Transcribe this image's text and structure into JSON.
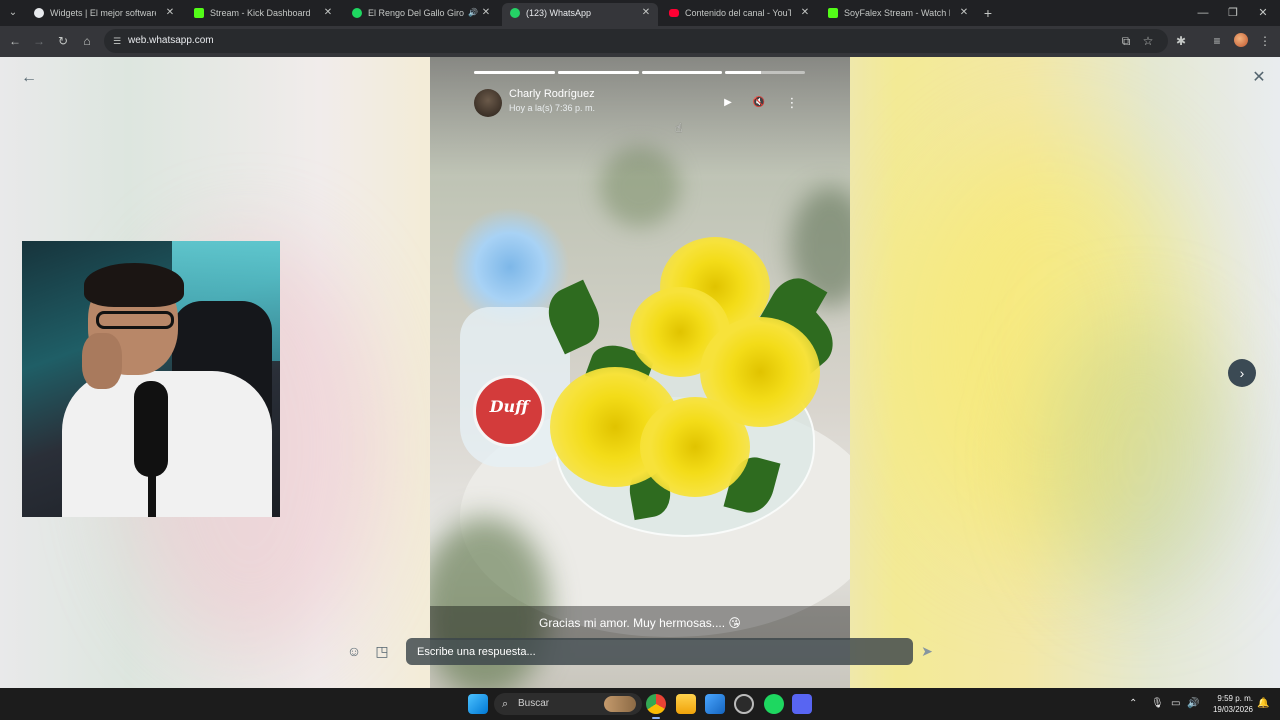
{
  "browser": {
    "tabs": [
      {
        "title": "Widgets | El mejor software pa",
        "favicon": "widgets-favicon-icon",
        "active": false
      },
      {
        "title": "Stream - Kick Dashboard",
        "favicon": "kick-favicon-icon",
        "active": false
      },
      {
        "title": "El Rengo Del Gallo Giro • L",
        "favicon": "spotify-favicon-icon",
        "active": false,
        "audio": true
      },
      {
        "title": "(123) WhatsApp",
        "favicon": "whatsapp-favicon-icon",
        "active": true
      },
      {
        "title": "Contenido del canal - YouTube",
        "favicon": "youtube-favicon-icon",
        "active": false
      },
      {
        "title": "SoyFalex Stream - Watch Live o",
        "favicon": "kick-favicon-icon",
        "active": false
      }
    ],
    "url": "web.whatsapp.com",
    "colors": {
      "tab_bar": "#202124",
      "toolbar": "#35363a",
      "kick": "#53fc18",
      "spotify": "#1ed760",
      "whatsapp": "#25d366",
      "youtube": "#ff0033"
    }
  },
  "status": {
    "contact_name": "Charly Rodríguez",
    "timestamp": "Hoy a la(s) 7:36 p. m.",
    "caption": "Gracias mi amor. Muy hermosas.... 😘",
    "progress": [
      1.0,
      1.0,
      1.0,
      0.45,
      0.0
    ],
    "photo_label": "Duff"
  },
  "reply": {
    "placeholder": "Escribe una respuesta..."
  },
  "taskbar": {
    "search_label": "Buscar",
    "time": "9:59 p. m.",
    "date": "19/03/2026"
  }
}
